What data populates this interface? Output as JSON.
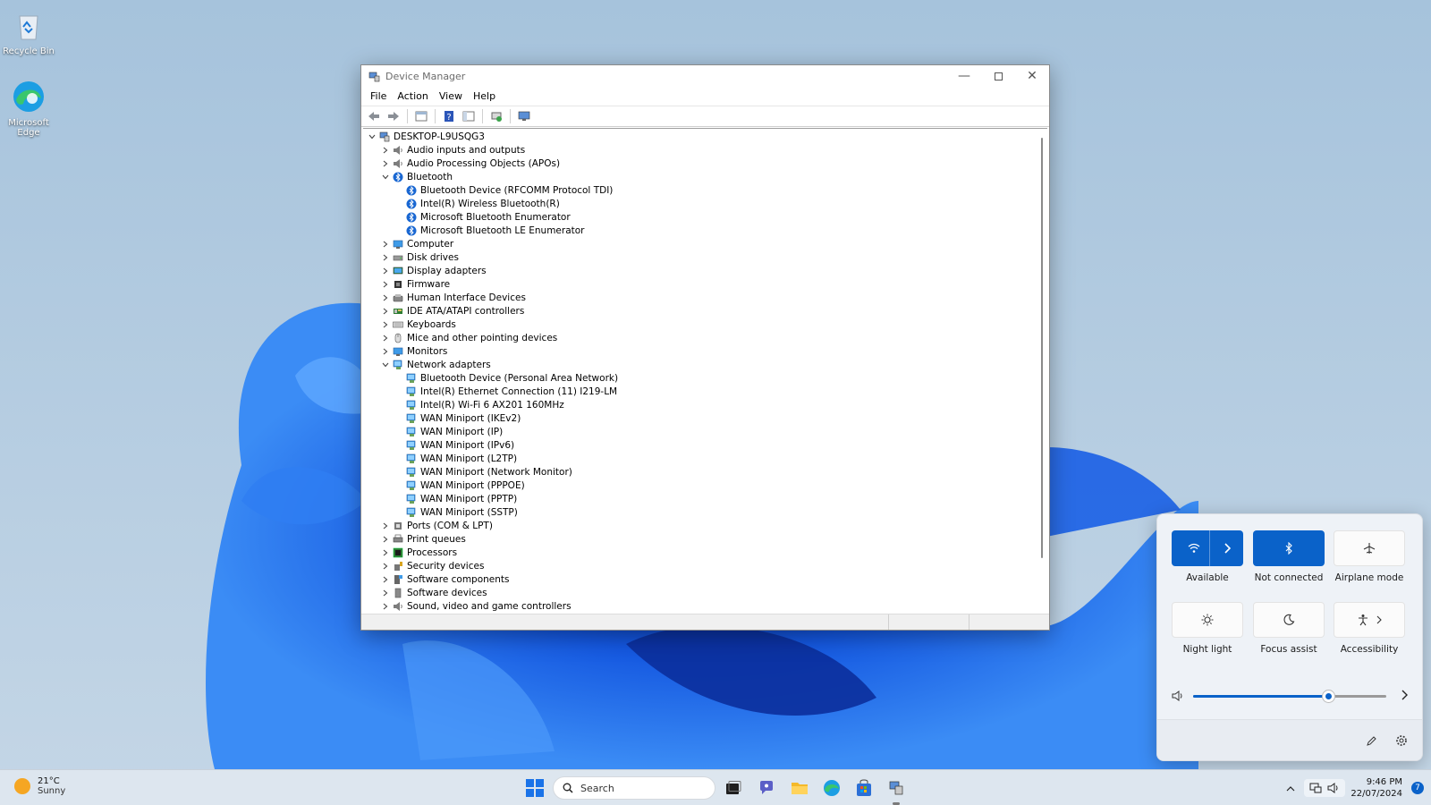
{
  "desktop": {
    "icons": [
      {
        "label": "Recycle Bin",
        "icon": "recycle-bin-icon"
      },
      {
        "label": "Microsoft Edge",
        "icon": "edge-icon"
      }
    ]
  },
  "window": {
    "title": "Device Manager",
    "menu": [
      "File",
      "Action",
      "View",
      "Help"
    ],
    "toolbar_icons": [
      "back-arrow-icon",
      "forward-arrow-icon",
      "properties-icon",
      "help-icon",
      "show-hide-console-icon",
      "update-driver-icon",
      "scan-hardware-icon"
    ],
    "tree": [
      {
        "level": 0,
        "expanded": true,
        "label": "DESKTOP-L9USQG3",
        "icon": "computer-root-icon"
      },
      {
        "level": 1,
        "expanded": false,
        "label": "Audio inputs and outputs",
        "icon": "speaker-icon"
      },
      {
        "level": 1,
        "expanded": false,
        "label": "Audio Processing Objects (APOs)",
        "icon": "speaker-icon"
      },
      {
        "level": 1,
        "expanded": true,
        "label": "Bluetooth",
        "icon": "bluetooth-icon"
      },
      {
        "level": 2,
        "label": "Bluetooth Device (RFCOMM Protocol TDI)",
        "icon": "bluetooth-icon"
      },
      {
        "level": 2,
        "label": "Intel(R) Wireless Bluetooth(R)",
        "icon": "bluetooth-icon"
      },
      {
        "level": 2,
        "label": "Microsoft Bluetooth Enumerator",
        "icon": "bluetooth-icon"
      },
      {
        "level": 2,
        "label": "Microsoft Bluetooth LE Enumerator",
        "icon": "bluetooth-icon"
      },
      {
        "level": 1,
        "expanded": false,
        "label": "Computer",
        "icon": "monitor-icon"
      },
      {
        "level": 1,
        "expanded": false,
        "label": "Disk drives",
        "icon": "disk-drive-icon"
      },
      {
        "level": 1,
        "expanded": false,
        "label": "Display adapters",
        "icon": "display-adapter-icon"
      },
      {
        "level": 1,
        "expanded": false,
        "label": "Firmware",
        "icon": "chip-icon"
      },
      {
        "level": 1,
        "expanded": false,
        "label": "Human Interface Devices",
        "icon": "hid-icon"
      },
      {
        "level": 1,
        "expanded": false,
        "label": "IDE ATA/ATAPI controllers",
        "icon": "ide-controller-icon"
      },
      {
        "level": 1,
        "expanded": false,
        "label": "Keyboards",
        "icon": "keyboard-icon"
      },
      {
        "level": 1,
        "expanded": false,
        "label": "Mice and other pointing devices",
        "icon": "mouse-icon"
      },
      {
        "level": 1,
        "expanded": false,
        "label": "Monitors",
        "icon": "monitor-icon"
      },
      {
        "level": 1,
        "expanded": true,
        "label": "Network adapters",
        "icon": "network-adapter-icon"
      },
      {
        "level": 2,
        "label": "Bluetooth Device (Personal Area Network)",
        "icon": "network-adapter-icon"
      },
      {
        "level": 2,
        "label": "Intel(R) Ethernet Connection (11) I219-LM",
        "icon": "network-adapter-icon"
      },
      {
        "level": 2,
        "label": "Intel(R) Wi-Fi 6 AX201 160MHz",
        "icon": "network-adapter-icon"
      },
      {
        "level": 2,
        "label": "WAN Miniport (IKEv2)",
        "icon": "network-adapter-icon"
      },
      {
        "level": 2,
        "label": "WAN Miniport (IP)",
        "icon": "network-adapter-icon"
      },
      {
        "level": 2,
        "label": "WAN Miniport (IPv6)",
        "icon": "network-adapter-icon"
      },
      {
        "level": 2,
        "label": "WAN Miniport (L2TP)",
        "icon": "network-adapter-icon"
      },
      {
        "level": 2,
        "label": "WAN Miniport (Network Monitor)",
        "icon": "network-adapter-icon"
      },
      {
        "level": 2,
        "label": "WAN Miniport (PPPOE)",
        "icon": "network-adapter-icon"
      },
      {
        "level": 2,
        "label": "WAN Miniport (PPTP)",
        "icon": "network-adapter-icon"
      },
      {
        "level": 2,
        "label": "WAN Miniport (SSTP)",
        "icon": "network-adapter-icon"
      },
      {
        "level": 1,
        "expanded": false,
        "label": "Ports (COM & LPT)",
        "icon": "port-icon"
      },
      {
        "level": 1,
        "expanded": false,
        "label": "Print queues",
        "icon": "printer-icon"
      },
      {
        "level": 1,
        "expanded": false,
        "label": "Processors",
        "icon": "processor-icon"
      },
      {
        "level": 1,
        "expanded": false,
        "label": "Security devices",
        "icon": "security-key-icon"
      },
      {
        "level": 1,
        "expanded": false,
        "label": "Software components",
        "icon": "software-component-icon"
      },
      {
        "level": 1,
        "expanded": false,
        "label": "Software devices",
        "icon": "software-device-icon"
      },
      {
        "level": 1,
        "expanded": false,
        "label": "Sound, video and game controllers",
        "icon": "speaker-icon"
      }
    ]
  },
  "quick_settings": {
    "tiles": [
      {
        "label": "Available",
        "icon": "wifi-icon",
        "active": true,
        "has_arrow": true
      },
      {
        "label": "Not connected",
        "icon": "bluetooth-icon",
        "active": true,
        "has_arrow": false
      },
      {
        "label": "Airplane mode",
        "icon": "airplane-icon",
        "active": false,
        "has_arrow": false
      },
      {
        "label": "Night light",
        "icon": "brightness-icon",
        "active": false,
        "has_arrow": false
      },
      {
        "label": "Focus assist",
        "icon": "moon-icon",
        "active": false,
        "has_arrow": false
      },
      {
        "label": "Accessibility",
        "icon": "accessibility-icon",
        "active": false,
        "has_arrow": true
      }
    ],
    "volume_level": 0.7
  },
  "taskbar": {
    "weather_temp": "21°C",
    "weather_condition": "Sunny",
    "search_placeholder": "Search",
    "time": "9:46 PM",
    "date": "22/07/2024",
    "notification_count": "7",
    "accent": "#0a62c9"
  }
}
